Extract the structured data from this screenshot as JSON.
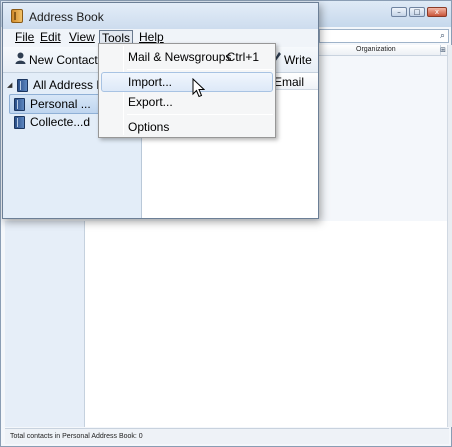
{
  "background_window": {
    "controls": {
      "minimize": "–",
      "maximize": "□",
      "close": "x"
    },
    "search_icon": "⌕",
    "column_organization": "Organization",
    "column_picker_icon": "⊞",
    "status_text": "Total contacts in Personal Address Book: 0"
  },
  "window": {
    "title": "Address Book",
    "icon": "address-book-icon"
  },
  "menubar": {
    "file": "File",
    "edit": "Edit",
    "view": "View",
    "tools": "Tools",
    "help": "Help"
  },
  "toolbar": {
    "new_contact": "New Contact",
    "new_contact_icon": "person-icon",
    "write": "Write",
    "write_icon": "pen-icon"
  },
  "results_header": {
    "email": "Email"
  },
  "sidebar": {
    "items": [
      {
        "label": "All Address B",
        "expanded": true
      },
      {
        "label": "Personal ...",
        "selected": true
      },
      {
        "label": "Collecte...d"
      }
    ]
  },
  "tools_menu": {
    "items": [
      {
        "label": "Mail & Newsgroups",
        "shortcut": "Ctrl+1"
      },
      {
        "label": "Import...",
        "hovered": true
      },
      {
        "label": "Export..."
      },
      {
        "label": "Options"
      }
    ]
  },
  "colors": {
    "sidebar_bg": "#e3edf8",
    "selection": "#bed5ef",
    "menu_bg": "#f5f6f7"
  }
}
